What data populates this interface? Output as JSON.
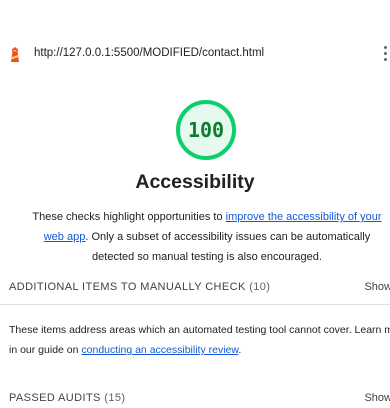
{
  "topbar": {
    "url": "http://127.0.0.1:5500/MODIFIED/contact.html",
    "logo_icon": "lighthouse-icon",
    "menu_icon": "kebab-menu-icon"
  },
  "category": {
    "score": "100",
    "score_fraction": 1.0,
    "score_color": "#0cce6b",
    "title": "Accessibility",
    "description_before": "These checks highlight opportunities to ",
    "description_link": "improve the accessibility of your web app",
    "description_after": ". Only a subset of accessibility issues can be automatically detected so manual testing is also encouraged."
  },
  "manual_section": {
    "label": "ADDITIONAL ITEMS TO MANUALLY CHECK",
    "count": "(10)",
    "toggle": "Show",
    "note_line1": "These items address areas which an automated testing tool cannot cover. Learn more",
    "note_before": "in our guide on ",
    "note_link": "conducting an accessibility review",
    "note_after": "."
  },
  "passed_section": {
    "label": "PASSED AUDITS",
    "count": "(15)",
    "toggle": "Show"
  },
  "colors": {
    "link": "#1558d6",
    "pass": "#0cce6b",
    "pass_text": "#0d7d2f"
  }
}
